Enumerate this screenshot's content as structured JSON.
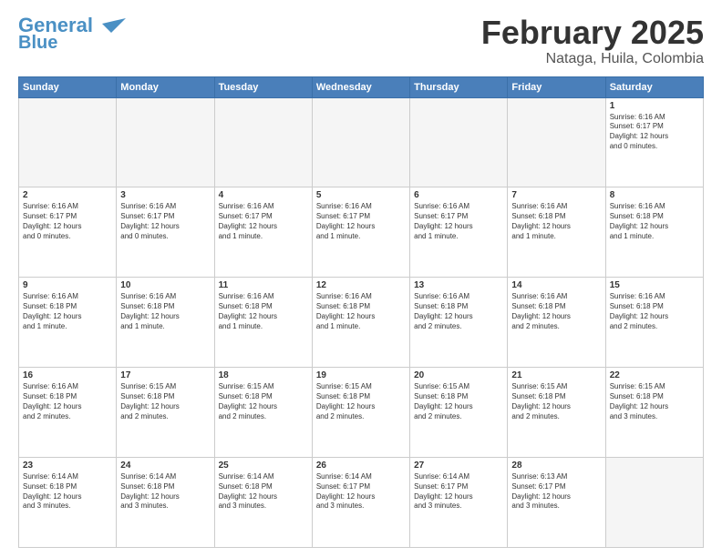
{
  "header": {
    "logo_line1": "General",
    "logo_line2": "Blue",
    "month": "February 2025",
    "location": "Nataga, Huila, Colombia"
  },
  "weekdays": [
    "Sunday",
    "Monday",
    "Tuesday",
    "Wednesday",
    "Thursday",
    "Friday",
    "Saturday"
  ],
  "weeks": [
    [
      {
        "day": "",
        "info": ""
      },
      {
        "day": "",
        "info": ""
      },
      {
        "day": "",
        "info": ""
      },
      {
        "day": "",
        "info": ""
      },
      {
        "day": "",
        "info": ""
      },
      {
        "day": "",
        "info": ""
      },
      {
        "day": "1",
        "info": "Sunrise: 6:16 AM\nSunset: 6:17 PM\nDaylight: 12 hours\nand 0 minutes."
      }
    ],
    [
      {
        "day": "2",
        "info": "Sunrise: 6:16 AM\nSunset: 6:17 PM\nDaylight: 12 hours\nand 0 minutes."
      },
      {
        "day": "3",
        "info": "Sunrise: 6:16 AM\nSunset: 6:17 PM\nDaylight: 12 hours\nand 0 minutes."
      },
      {
        "day": "4",
        "info": "Sunrise: 6:16 AM\nSunset: 6:17 PM\nDaylight: 12 hours\nand 1 minute."
      },
      {
        "day": "5",
        "info": "Sunrise: 6:16 AM\nSunset: 6:17 PM\nDaylight: 12 hours\nand 1 minute."
      },
      {
        "day": "6",
        "info": "Sunrise: 6:16 AM\nSunset: 6:17 PM\nDaylight: 12 hours\nand 1 minute."
      },
      {
        "day": "7",
        "info": "Sunrise: 6:16 AM\nSunset: 6:18 PM\nDaylight: 12 hours\nand 1 minute."
      },
      {
        "day": "8",
        "info": "Sunrise: 6:16 AM\nSunset: 6:18 PM\nDaylight: 12 hours\nand 1 minute."
      }
    ],
    [
      {
        "day": "9",
        "info": "Sunrise: 6:16 AM\nSunset: 6:18 PM\nDaylight: 12 hours\nand 1 minute."
      },
      {
        "day": "10",
        "info": "Sunrise: 6:16 AM\nSunset: 6:18 PM\nDaylight: 12 hours\nand 1 minute."
      },
      {
        "day": "11",
        "info": "Sunrise: 6:16 AM\nSunset: 6:18 PM\nDaylight: 12 hours\nand 1 minute."
      },
      {
        "day": "12",
        "info": "Sunrise: 6:16 AM\nSunset: 6:18 PM\nDaylight: 12 hours\nand 1 minute."
      },
      {
        "day": "13",
        "info": "Sunrise: 6:16 AM\nSunset: 6:18 PM\nDaylight: 12 hours\nand 2 minutes."
      },
      {
        "day": "14",
        "info": "Sunrise: 6:16 AM\nSunset: 6:18 PM\nDaylight: 12 hours\nand 2 minutes."
      },
      {
        "day": "15",
        "info": "Sunrise: 6:16 AM\nSunset: 6:18 PM\nDaylight: 12 hours\nand 2 minutes."
      }
    ],
    [
      {
        "day": "16",
        "info": "Sunrise: 6:16 AM\nSunset: 6:18 PM\nDaylight: 12 hours\nand 2 minutes."
      },
      {
        "day": "17",
        "info": "Sunrise: 6:15 AM\nSunset: 6:18 PM\nDaylight: 12 hours\nand 2 minutes."
      },
      {
        "day": "18",
        "info": "Sunrise: 6:15 AM\nSunset: 6:18 PM\nDaylight: 12 hours\nand 2 minutes."
      },
      {
        "day": "19",
        "info": "Sunrise: 6:15 AM\nSunset: 6:18 PM\nDaylight: 12 hours\nand 2 minutes."
      },
      {
        "day": "20",
        "info": "Sunrise: 6:15 AM\nSunset: 6:18 PM\nDaylight: 12 hours\nand 2 minutes."
      },
      {
        "day": "21",
        "info": "Sunrise: 6:15 AM\nSunset: 6:18 PM\nDaylight: 12 hours\nand 2 minutes."
      },
      {
        "day": "22",
        "info": "Sunrise: 6:15 AM\nSunset: 6:18 PM\nDaylight: 12 hours\nand 3 minutes."
      }
    ],
    [
      {
        "day": "23",
        "info": "Sunrise: 6:14 AM\nSunset: 6:18 PM\nDaylight: 12 hours\nand 3 minutes."
      },
      {
        "day": "24",
        "info": "Sunrise: 6:14 AM\nSunset: 6:18 PM\nDaylight: 12 hours\nand 3 minutes."
      },
      {
        "day": "25",
        "info": "Sunrise: 6:14 AM\nSunset: 6:18 PM\nDaylight: 12 hours\nand 3 minutes."
      },
      {
        "day": "26",
        "info": "Sunrise: 6:14 AM\nSunset: 6:17 PM\nDaylight: 12 hours\nand 3 minutes."
      },
      {
        "day": "27",
        "info": "Sunrise: 6:14 AM\nSunset: 6:17 PM\nDaylight: 12 hours\nand 3 minutes."
      },
      {
        "day": "28",
        "info": "Sunrise: 6:13 AM\nSunset: 6:17 PM\nDaylight: 12 hours\nand 3 minutes."
      },
      {
        "day": "",
        "info": ""
      }
    ]
  ]
}
